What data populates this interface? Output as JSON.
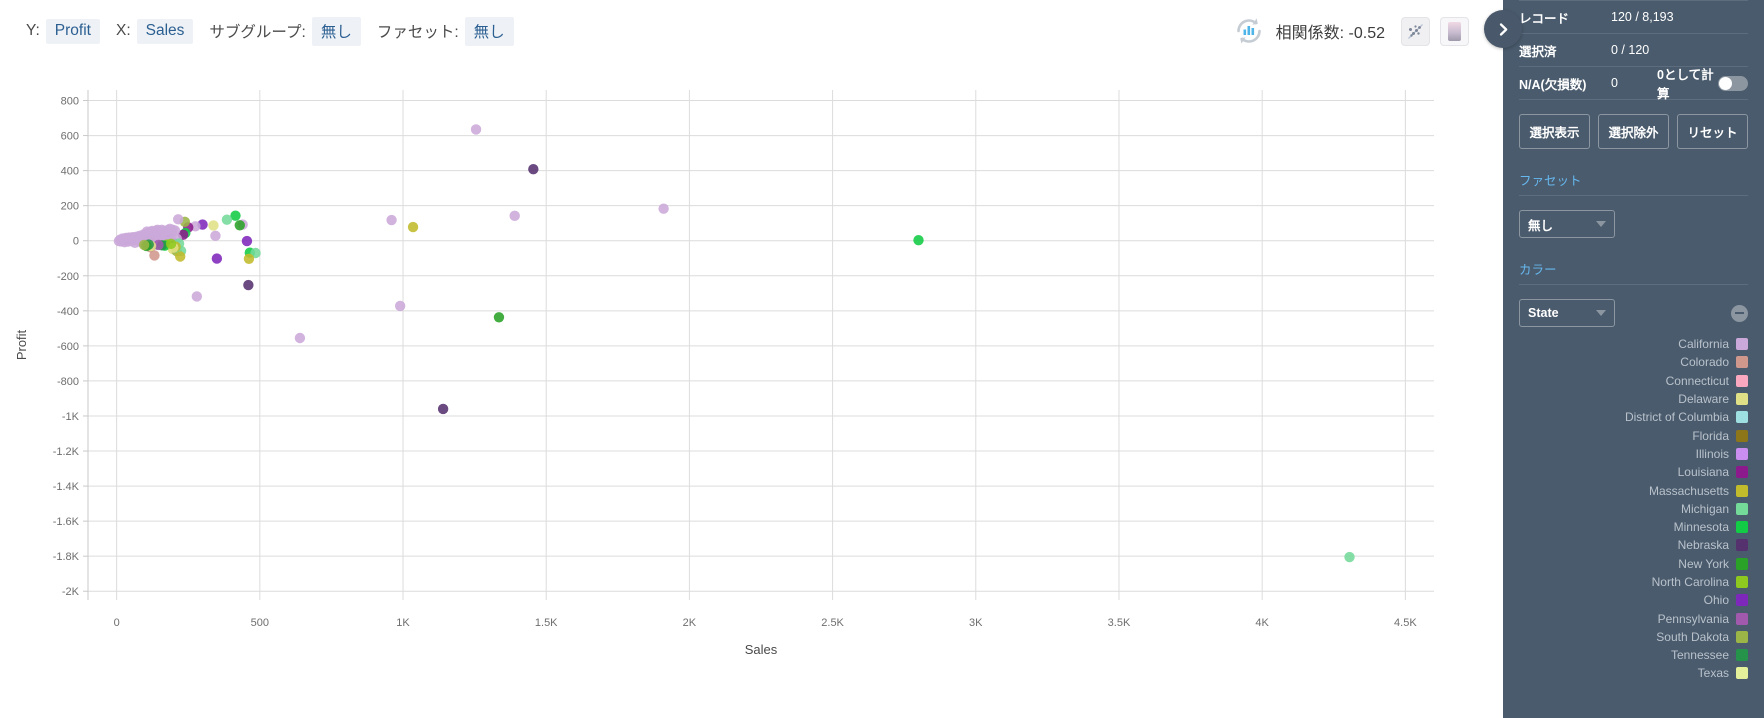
{
  "toolbar": {
    "y_label": "Y:",
    "y_value": "Profit",
    "x_label": "X:",
    "x_value": "Sales",
    "subgroup_label": "サブグループ:",
    "subgroup_value": "無し",
    "facet_label": "ファセット:",
    "facet_value": "無し",
    "correlation_text": "相関係数: -0.52",
    "refresh_icon": "refresh-chart-icon",
    "scatter_icon": "scatter-plot-icon",
    "gradient_icon": "color-gradient-icon",
    "expand_icon": "chevron-right-icon"
  },
  "sidebar": {
    "stats": [
      {
        "name": "レコード",
        "value": "120 / 8,193"
      },
      {
        "name": "選択済",
        "value": "0 / 120"
      }
    ],
    "na_row": {
      "name": "N/A(欠損数)",
      "value": "0",
      "extra": "0として計算",
      "toggle_on": false
    },
    "buttons": [
      {
        "label": "選択表示",
        "name": "show-selection-button"
      },
      {
        "label": "選択除外",
        "name": "exclude-selection-button"
      },
      {
        "label": "リセット",
        "name": "reset-button"
      }
    ],
    "facet_section": {
      "title": "ファセット",
      "select_value": "無し"
    },
    "color_section": {
      "title": "カラー",
      "select_value": "State"
    },
    "legend": [
      {
        "label": "California",
        "color": "#cba8da"
      },
      {
        "label": "Colorado",
        "color": "#d0978c"
      },
      {
        "label": "Connecticut",
        "color": "#f9a8c0"
      },
      {
        "label": "Delaware",
        "color": "#e0e086"
      },
      {
        "label": "District of Columbia",
        "color": "#9ee0e2"
      },
      {
        "label": "Florida",
        "color": "#8d7519"
      },
      {
        "label": "Illinois",
        "color": "#c98ef0"
      },
      {
        "label": "Louisiana",
        "color": "#8c1a8c"
      },
      {
        "label": "Massachusetts",
        "color": "#c2bb2b"
      },
      {
        "label": "Michigan",
        "color": "#73da9a"
      },
      {
        "label": "Minnesota",
        "color": "#11cc44"
      },
      {
        "label": "Nebraska",
        "color": "#55316e"
      },
      {
        "label": "New York",
        "color": "#2aa228"
      },
      {
        "label": "North Carolina",
        "color": "#8ec91f"
      },
      {
        "label": "Ohio",
        "color": "#7e27bb"
      },
      {
        "label": "Pennsylvania",
        "color": "#a159ae"
      },
      {
        "label": "South Dakota",
        "color": "#9bb546"
      },
      {
        "label": "Tennessee",
        "color": "#25944a"
      },
      {
        "label": "Texas",
        "color": "#e5f09a"
      }
    ]
  },
  "chart_data": {
    "type": "scatter",
    "title": "",
    "xlabel": "Sales",
    "ylabel": "Profit",
    "xlim": [
      -100,
      4600
    ],
    "ylim": [
      -2050,
      860
    ],
    "grid": true,
    "xticks": [
      0,
      500,
      1000,
      1500,
      2000,
      2500,
      3000,
      3500,
      4000,
      4500
    ],
    "xticklabels": [
      "0",
      "500",
      "1K",
      "1.5K",
      "2K",
      "2.5K",
      "3K",
      "3.5K",
      "4K",
      "4.5K"
    ],
    "yticks": [
      800,
      600,
      400,
      200,
      0,
      -200,
      -400,
      -600,
      -800,
      -1000,
      -1200,
      -1400,
      -1600,
      -1800,
      -2000
    ],
    "yticklabels": [
      "800",
      "600",
      "400",
      "200",
      "0",
      "-200",
      "-400",
      "-600",
      "-800",
      "-1K",
      "-1.2K",
      "-1.4K",
      "-1.6K",
      "-1.8K",
      "-2K"
    ],
    "color_by": "State",
    "correlation": -0.52,
    "point_count_shown": 120,
    "points": [
      {
        "x": 1255,
        "y": 635,
        "c": "#cba8da"
      },
      {
        "x": 1455,
        "y": 408,
        "c": "#55316e"
      },
      {
        "x": 1910,
        "y": 183,
        "c": "#cba8da"
      },
      {
        "x": 1390,
        "y": 142,
        "c": "#cba8da"
      },
      {
        "x": 960,
        "y": 118,
        "c": "#cba8da"
      },
      {
        "x": 1035,
        "y": 78,
        "c": "#c2bb2b"
      },
      {
        "x": 2800,
        "y": 3,
        "c": "#11cc44"
      },
      {
        "x": 4305,
        "y": -1805,
        "c": "#73da9a"
      },
      {
        "x": 990,
        "y": -372,
        "c": "#cba8da"
      },
      {
        "x": 1335,
        "y": -437,
        "c": "#2aa228"
      },
      {
        "x": 640,
        "y": -555,
        "c": "#cba8da"
      },
      {
        "x": 1140,
        "y": -960,
        "c": "#55316e"
      },
      {
        "x": 280,
        "y": -318,
        "c": "#cba8da"
      },
      {
        "x": 460,
        "y": -253,
        "c": "#55316e"
      },
      {
        "x": 440,
        "y": 92,
        "c": "#cba8da"
      },
      {
        "x": 415,
        "y": 143,
        "c": "#11cc44"
      },
      {
        "x": 385,
        "y": 120,
        "c": "#73da9a"
      },
      {
        "x": 430,
        "y": 88,
        "c": "#2aa228"
      },
      {
        "x": 455,
        "y": -2,
        "c": "#7e27bb"
      },
      {
        "x": 465,
        "y": -68,
        "c": "#11cc44"
      },
      {
        "x": 485,
        "y": -70,
        "c": "#73da9a"
      },
      {
        "x": 462,
        "y": -103,
        "c": "#c2bb2b"
      },
      {
        "x": 350,
        "y": -102,
        "c": "#7e27bb"
      },
      {
        "x": 345,
        "y": 28,
        "c": "#cba8da"
      },
      {
        "x": 338,
        "y": 87,
        "c": "#e0e086"
      },
      {
        "x": 300,
        "y": 92,
        "c": "#7e27bb"
      },
      {
        "x": 275,
        "y": 82,
        "c": "#cba8da"
      },
      {
        "x": 250,
        "y": 76,
        "c": "#8c1a8c"
      },
      {
        "x": 238,
        "y": 108,
        "c": "#9bb546"
      },
      {
        "x": 240,
        "y": 44,
        "c": "#11cc44"
      },
      {
        "x": 232,
        "y": 34,
        "c": "#8c1a8c"
      },
      {
        "x": 215,
        "y": 122,
        "c": "#cba8da"
      },
      {
        "x": 200,
        "y": -14,
        "c": "#55316e"
      },
      {
        "x": 196,
        "y": -48,
        "c": "#e0e086"
      },
      {
        "x": 210,
        "y": -60,
        "c": "#9bb546"
      },
      {
        "x": 225,
        "y": -58,
        "c": "#73da9a"
      },
      {
        "x": 222,
        "y": -90,
        "c": "#c2bb2b"
      },
      {
        "x": 170,
        "y": -12,
        "c": "#cba8da"
      },
      {
        "x": 162,
        "y": 40,
        "c": "#cba8da"
      },
      {
        "x": 158,
        "y": 62,
        "c": "#cba8da"
      },
      {
        "x": 148,
        "y": 30,
        "c": "#2aa228"
      },
      {
        "x": 140,
        "y": 48,
        "c": "#cba8da"
      },
      {
        "x": 135,
        "y": -20,
        "c": "#11cc44"
      },
      {
        "x": 128,
        "y": -8,
        "c": "#cba8da"
      },
      {
        "x": 122,
        "y": 24,
        "c": "#8c7519"
      },
      {
        "x": 118,
        "y": -38,
        "c": "#d0978c"
      },
      {
        "x": 132,
        "y": -84,
        "c": "#d0978c"
      },
      {
        "x": 110,
        "y": 20,
        "c": "#cba8da"
      },
      {
        "x": 104,
        "y": -4,
        "c": "#cba8da"
      },
      {
        "x": 98,
        "y": 12,
        "c": "#f9a8c0"
      },
      {
        "x": 92,
        "y": -10,
        "c": "#cba8da"
      },
      {
        "x": 88,
        "y": 6,
        "c": "#cba8da"
      },
      {
        "x": 82,
        "y": -6,
        "c": "#cba8da"
      },
      {
        "x": 78,
        "y": 14,
        "c": "#cba8da"
      },
      {
        "x": 70,
        "y": 2,
        "c": "#cba8da"
      },
      {
        "x": 64,
        "y": -12,
        "c": "#cba8da"
      },
      {
        "x": 58,
        "y": 8,
        "c": "#cba8da"
      },
      {
        "x": 52,
        "y": -2,
        "c": "#cba8da"
      },
      {
        "x": 46,
        "y": 10,
        "c": "#cba8da"
      },
      {
        "x": 40,
        "y": -5,
        "c": "#cba8da"
      },
      {
        "x": 34,
        "y": 4,
        "c": "#cba8da"
      },
      {
        "x": 28,
        "y": -8,
        "c": "#cba8da"
      },
      {
        "x": 22,
        "y": 2,
        "c": "#cba8da"
      },
      {
        "x": 16,
        "y": -4,
        "c": "#cba8da"
      },
      {
        "x": 12,
        "y": 6,
        "c": "#cba8da"
      },
      {
        "x": 8,
        "y": -2,
        "c": "#cba8da"
      },
      {
        "x": 150,
        "y": -6,
        "c": "#cba8da"
      },
      {
        "x": 144,
        "y": 14,
        "c": "#cba8da"
      },
      {
        "x": 138,
        "y": -2,
        "c": "#cba8da"
      },
      {
        "x": 126,
        "y": 44,
        "c": "#cba8da"
      },
      {
        "x": 116,
        "y": 34,
        "c": "#cba8da"
      },
      {
        "x": 108,
        "y": 42,
        "c": "#cba8da"
      },
      {
        "x": 100,
        "y": 30,
        "c": "#cba8da"
      },
      {
        "x": 94,
        "y": 36,
        "c": "#cba8da"
      },
      {
        "x": 86,
        "y": 24,
        "c": "#cba8da"
      },
      {
        "x": 80,
        "y": 28,
        "c": "#cba8da"
      },
      {
        "x": 74,
        "y": 18,
        "c": "#cba8da"
      },
      {
        "x": 68,
        "y": 22,
        "c": "#cba8da"
      },
      {
        "x": 62,
        "y": 16,
        "c": "#cba8da"
      },
      {
        "x": 56,
        "y": 20,
        "c": "#cba8da"
      },
      {
        "x": 50,
        "y": 14,
        "c": "#cba8da"
      },
      {
        "x": 44,
        "y": 18,
        "c": "#cba8da"
      },
      {
        "x": 38,
        "y": 12,
        "c": "#cba8da"
      },
      {
        "x": 32,
        "y": 16,
        "c": "#cba8da"
      },
      {
        "x": 26,
        "y": 10,
        "c": "#cba8da"
      },
      {
        "x": 20,
        "y": 12,
        "c": "#cba8da"
      },
      {
        "x": 156,
        "y": 22,
        "c": "#cba8da"
      },
      {
        "x": 164,
        "y": 10,
        "c": "#cba8da"
      },
      {
        "x": 172,
        "y": 30,
        "c": "#cba8da"
      },
      {
        "x": 180,
        "y": 18,
        "c": "#cba8da"
      },
      {
        "x": 188,
        "y": 26,
        "c": "#cba8da"
      },
      {
        "x": 176,
        "y": -22,
        "c": "#8ec91f"
      },
      {
        "x": 168,
        "y": -28,
        "c": "#11cc44"
      },
      {
        "x": 158,
        "y": -26,
        "c": "#25944a"
      },
      {
        "x": 146,
        "y": -24,
        "c": "#a159ae"
      },
      {
        "x": 184,
        "y": 52,
        "c": "#c98ef0"
      },
      {
        "x": 192,
        "y": 46,
        "c": "#cba8da"
      },
      {
        "x": 204,
        "y": 58,
        "c": "#cba8da"
      },
      {
        "x": 196,
        "y": 62,
        "c": "#cba8da"
      },
      {
        "x": 186,
        "y": 68,
        "c": "#cba8da"
      },
      {
        "x": 178,
        "y": 60,
        "c": "#cba8da"
      },
      {
        "x": 170,
        "y": 54,
        "c": "#cba8da"
      },
      {
        "x": 162,
        "y": 48,
        "c": "#cba8da"
      },
      {
        "x": 154,
        "y": 52,
        "c": "#cba8da"
      },
      {
        "x": 148,
        "y": 58,
        "c": "#cba8da"
      },
      {
        "x": 142,
        "y": 62,
        "c": "#cba8da"
      },
      {
        "x": 136,
        "y": 54,
        "c": "#cba8da"
      },
      {
        "x": 130,
        "y": 50,
        "c": "#cba8da"
      },
      {
        "x": 124,
        "y": 56,
        "c": "#cba8da"
      },
      {
        "x": 118,
        "y": 50,
        "c": "#cba8da"
      },
      {
        "x": 112,
        "y": 46,
        "c": "#cba8da"
      },
      {
        "x": 106,
        "y": 52,
        "c": "#cba8da"
      },
      {
        "x": 120,
        "y": -30,
        "c": "#e0e086"
      },
      {
        "x": 112,
        "y": -22,
        "c": "#25944a"
      },
      {
        "x": 104,
        "y": -30,
        "c": "#2aa228"
      },
      {
        "x": 96,
        "y": -24,
        "c": "#9bb546"
      },
      {
        "x": 210,
        "y": 12,
        "c": "#cba8da"
      },
      {
        "x": 218,
        "y": -16,
        "c": "#73da9a"
      },
      {
        "x": 206,
        "y": -34,
        "c": "#c2bb2b"
      },
      {
        "x": 198,
        "y": -40,
        "c": "#e0e086"
      },
      {
        "x": 190,
        "y": -18,
        "c": "#8ec91f"
      }
    ]
  }
}
